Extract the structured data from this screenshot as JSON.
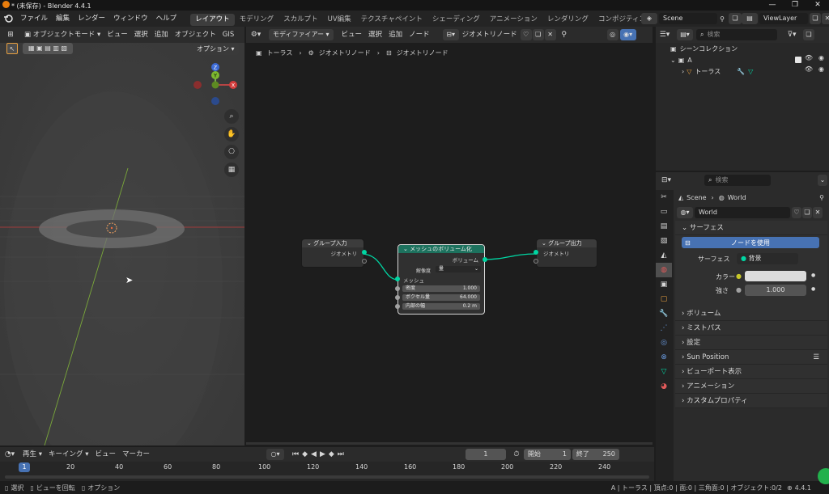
{
  "window": {
    "title": "* (未保存) - Blender 4.4.1",
    "min": "—",
    "max": "❐",
    "close": "✕"
  },
  "menu": {
    "file": "ファイル",
    "edit": "編集",
    "render": "レンダー",
    "window": "ウィンドウ",
    "help": "ヘルプ"
  },
  "workspaces": [
    "レイアウト",
    "モデリング",
    "スカルプト",
    "UV編集",
    "テクスチャペイント",
    "シェーディング",
    "アニメーション",
    "レンダリング",
    "コンポジティング"
  ],
  "scene": {
    "name": "Scene",
    "viewlayer": "ViewLayer"
  },
  "viewport": {
    "mode": "オブジェクトモード",
    "view": "ビュー",
    "select": "選択",
    "add": "追加",
    "object": "オブジェクト",
    "gis": "GIS",
    "options": "オプション",
    "gizmo": {
      "z": "Z",
      "y": "Y",
      "x": "X"
    }
  },
  "node_editor": {
    "type": "モディファイアー",
    "view": "ビュー",
    "select": "選択",
    "add": "追加",
    "node": "ノード",
    "tree": "ジオメトリノード",
    "breadcrumb": [
      "トーラス",
      "ジオメトリノード",
      "ジオメトリノード"
    ],
    "nodes": {
      "group_input": {
        "title": "グループ入力",
        "out_geometry": "ジオメトリ"
      },
      "mesh_to_volume": {
        "title": "メッシュのボリューム化",
        "out_volume": "ボリューム",
        "resolution_label": "解像度",
        "resolution_value": "量",
        "in_mesh": "メッシュ",
        "density_label": "密度",
        "density_value": "1.000",
        "voxel_amount_label": "ボクセル量",
        "voxel_amount_value": "64.000",
        "interior_band_label": "内部の幅",
        "interior_band_value": "0.2 m"
      },
      "group_output": {
        "title": "グループ出力",
        "in_geometry": "ジオメトリ"
      }
    }
  },
  "outliner": {
    "search_placeholder": "検索",
    "scene_collection": "シーンコレクション",
    "collection": "A",
    "object": "トーラス"
  },
  "properties": {
    "search_placeholder": "検索",
    "crumb_scene": "Scene",
    "crumb_world": "World",
    "world_name": "World",
    "surface_section": "サーフェス",
    "use_nodes": "ノードを使用",
    "surface_label": "サーフェス",
    "surface_value": "背景",
    "color_label": "カラー",
    "strength_label": "強さ",
    "strength_value": "1.000",
    "sections": [
      "ボリューム",
      "ミストパス",
      "設定",
      "Sun Position",
      "ビューポート表示",
      "アニメーション",
      "カスタムプロパティ"
    ]
  },
  "timeline": {
    "playback": "再生",
    "keying": "キーイング",
    "view": "ビュー",
    "marker": "マーカー",
    "current_frame": "1",
    "start_label": "開始",
    "start": "1",
    "end_label": "終了",
    "end": "250",
    "ticks": [
      "1",
      "20",
      "40",
      "60",
      "80",
      "100",
      "120",
      "140",
      "160",
      "180",
      "200",
      "220",
      "240"
    ]
  },
  "status": {
    "select": "選択",
    "rotate": "ビューを回転",
    "options": "オプション",
    "info": "A | トーラス | 頂点:0 | 面:0 | 三角面:0 | オブジェクト:0/2",
    "version": "4.4.1"
  },
  "colors": {
    "accent": "#4772b3",
    "geometry_socket": "#00d6a3",
    "node_header_geo": "#1d725e",
    "float_socket": "#a1a1a1"
  }
}
